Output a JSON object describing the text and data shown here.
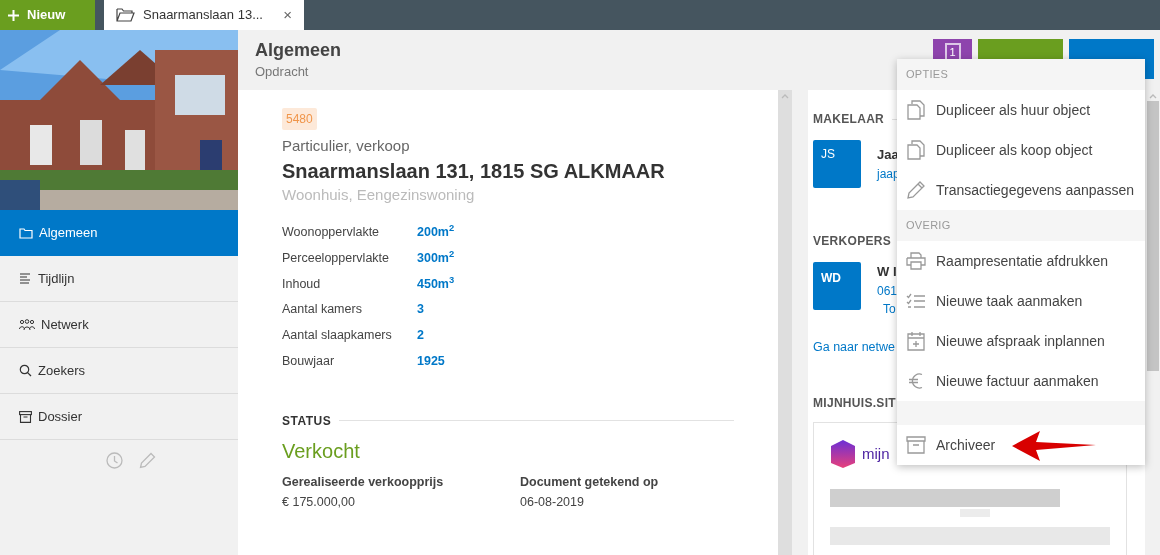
{
  "topbar": {
    "new_button": "Nieuw",
    "tab": {
      "title": "Snaarmanslaan 13...",
      "close": "×"
    }
  },
  "sidebar": {
    "items": [
      {
        "label": "Algemeen",
        "selected": true
      },
      {
        "label": "Tijdlijn",
        "selected": false
      },
      {
        "label": "Netwerk",
        "selected": false
      },
      {
        "label": "Zoekers",
        "selected": false
      },
      {
        "label": "Dossier",
        "selected": false
      }
    ]
  },
  "header": {
    "title": "Algemeen",
    "subtitle": "Opdracht",
    "count_button": "1"
  },
  "object": {
    "number": "5480",
    "category": "Particulier, verkoop",
    "address": "Snaarmanslaan 131, 1815 SG ALKMAAR",
    "type": "Woonhuis, Eengezinswoning",
    "specs": [
      {
        "label": "Woonoppervlakte",
        "value": "200m$^{2}$"
      },
      {
        "label": "Perceeloppervlakte",
        "value": "300m$^{2}$"
      },
      {
        "label": "Inhoud",
        "value": "450m$^{3}$"
      },
      {
        "label": "Aantal kamers",
        "value": "3"
      },
      {
        "label": "Aantal slaapkamers",
        "value": "2"
      },
      {
        "label": "Bouwjaar",
        "value": "1925"
      }
    ],
    "status": {
      "heading": "STATUS",
      "value": "Verkocht",
      "fields": [
        {
          "label": "Gerealiseerde verkoopprijs",
          "value": "€ 175.000,00"
        },
        {
          "label": "Document getekend op",
          "value": "06-08-2019"
        }
      ]
    }
  },
  "right_panel": {
    "agent": {
      "heading": "MAKELAAR",
      "initials": "JS",
      "name": "Jaa",
      "link": "jaap"
    },
    "sellers": {
      "heading": "VERKOPERS",
      "initials": "WD",
      "name": "W I",
      "phone": "061",
      "extra": "To",
      "link": "Ga naar netwe"
    },
    "site": {
      "heading": "MIJNHUIS.SIT",
      "logo_text": "mijn"
    }
  },
  "menu": {
    "sections": [
      {
        "header": "OPTIES",
        "items": [
          "Dupliceer als huur object",
          "Dupliceer als koop object",
          "Transactiegegevens aanpassen"
        ]
      },
      {
        "header": "OVERIG",
        "items": [
          "Raampresentatie afdrukken",
          "Nieuwe taak aanmaken",
          "Nieuwe afspraak inplannen",
          "Nieuwe factuur aanmaken"
        ]
      },
      {
        "items": [
          "Archiveer"
        ]
      }
    ]
  }
}
